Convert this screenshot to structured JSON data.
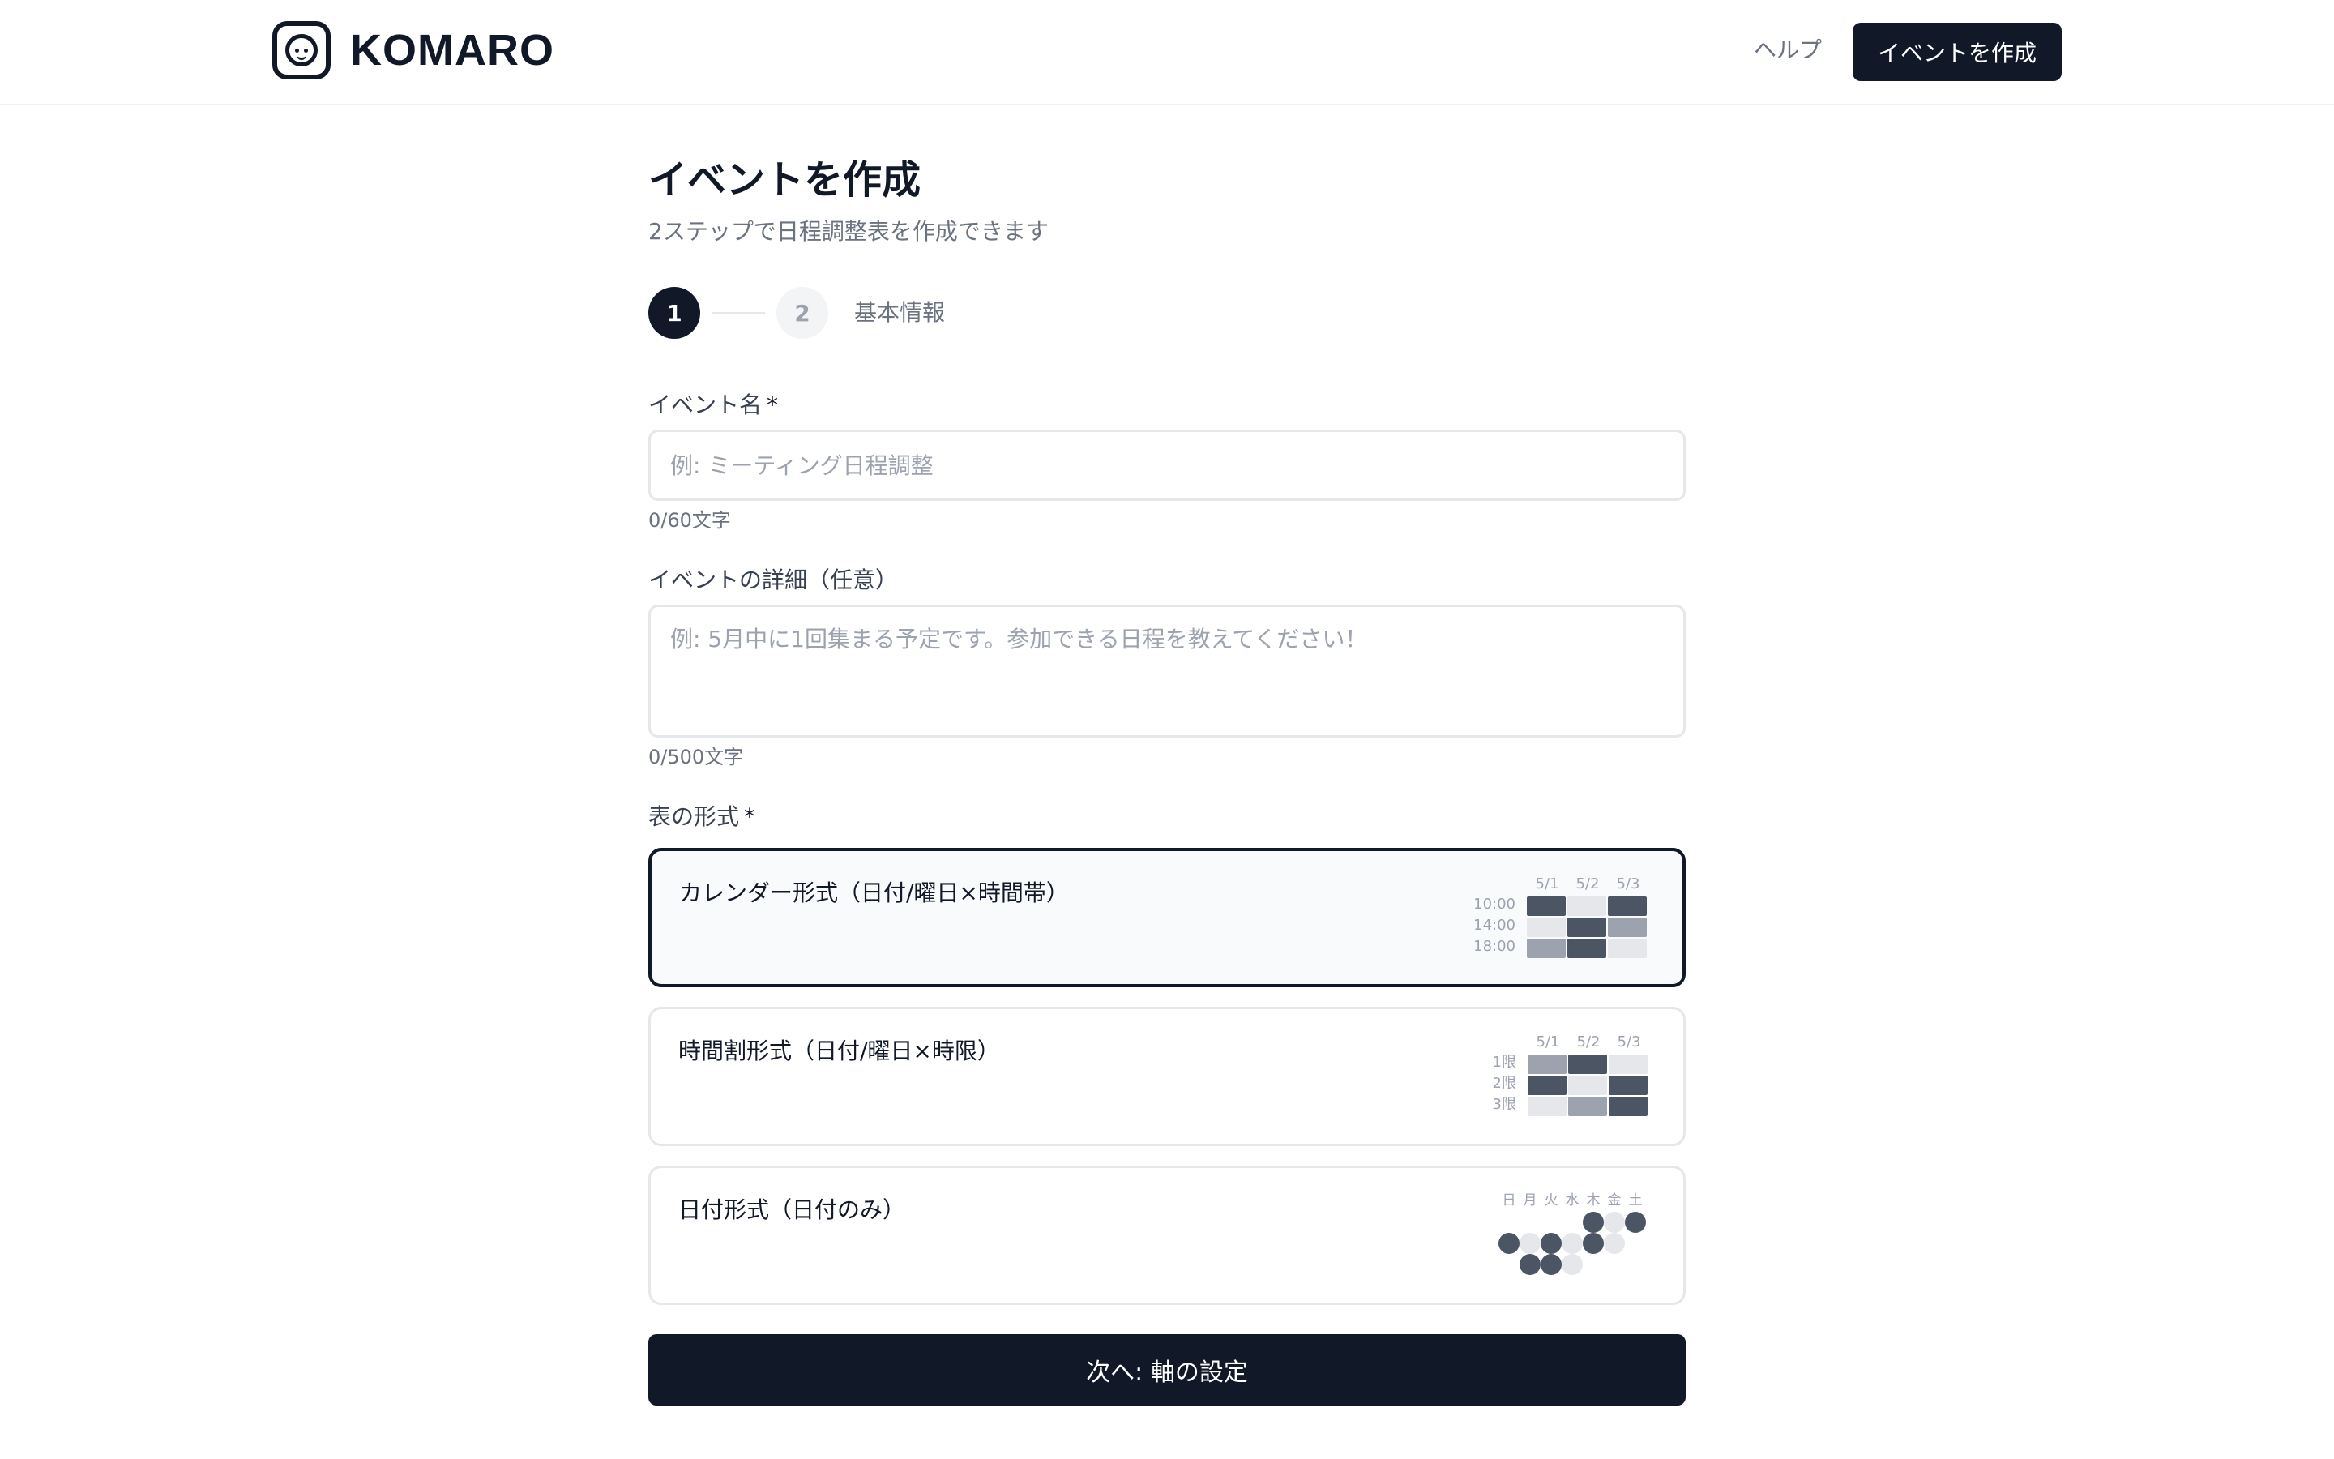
{
  "header": {
    "brand": "KOMARO",
    "help_label": "ヘルプ",
    "create_label": "イベントを作成"
  },
  "page": {
    "title": "イベントを作成",
    "subtitle": "2ステップで日程調整表を作成できます"
  },
  "steps": {
    "step1": "1",
    "step2": "2",
    "current_label": "基本情報"
  },
  "form": {
    "name_label": "イベント名",
    "required_mark": "*",
    "name_placeholder": "例: ミーティング日程調整",
    "name_counter": "0/60文字",
    "detail_label": "イベントの詳細（任意）",
    "detail_placeholder": "例: 5月中に1回集まる予定です。参加できる日程を教えてください！",
    "detail_counter": "0/500文字",
    "format_label": "表の形式",
    "next_label": "次へ: 軸の設定"
  },
  "formats": [
    {
      "title": "カレンダー形式（日付/曜日×時間帯）",
      "selected": true,
      "columns": [
        "5/1",
        "5/2",
        "5/3"
      ],
      "rows": [
        "10:00",
        "14:00",
        "18:00"
      ]
    },
    {
      "title": "時間割形式（日付/曜日×時限）",
      "selected": false,
      "columns": [
        "5/1",
        "5/2",
        "5/3"
      ],
      "rows": [
        "1限",
        "2限",
        "3限"
      ]
    },
    {
      "title": "日付形式（日付のみ）",
      "selected": false,
      "weekdays": [
        "日",
        "月",
        "火",
        "水",
        "木",
        "金",
        "土"
      ]
    }
  ],
  "colors": {
    "primary": "#111827",
    "cell_dark": "#4b5563",
    "cell_mid": "#9ca3af",
    "cell_light": "#e5e7eb"
  }
}
